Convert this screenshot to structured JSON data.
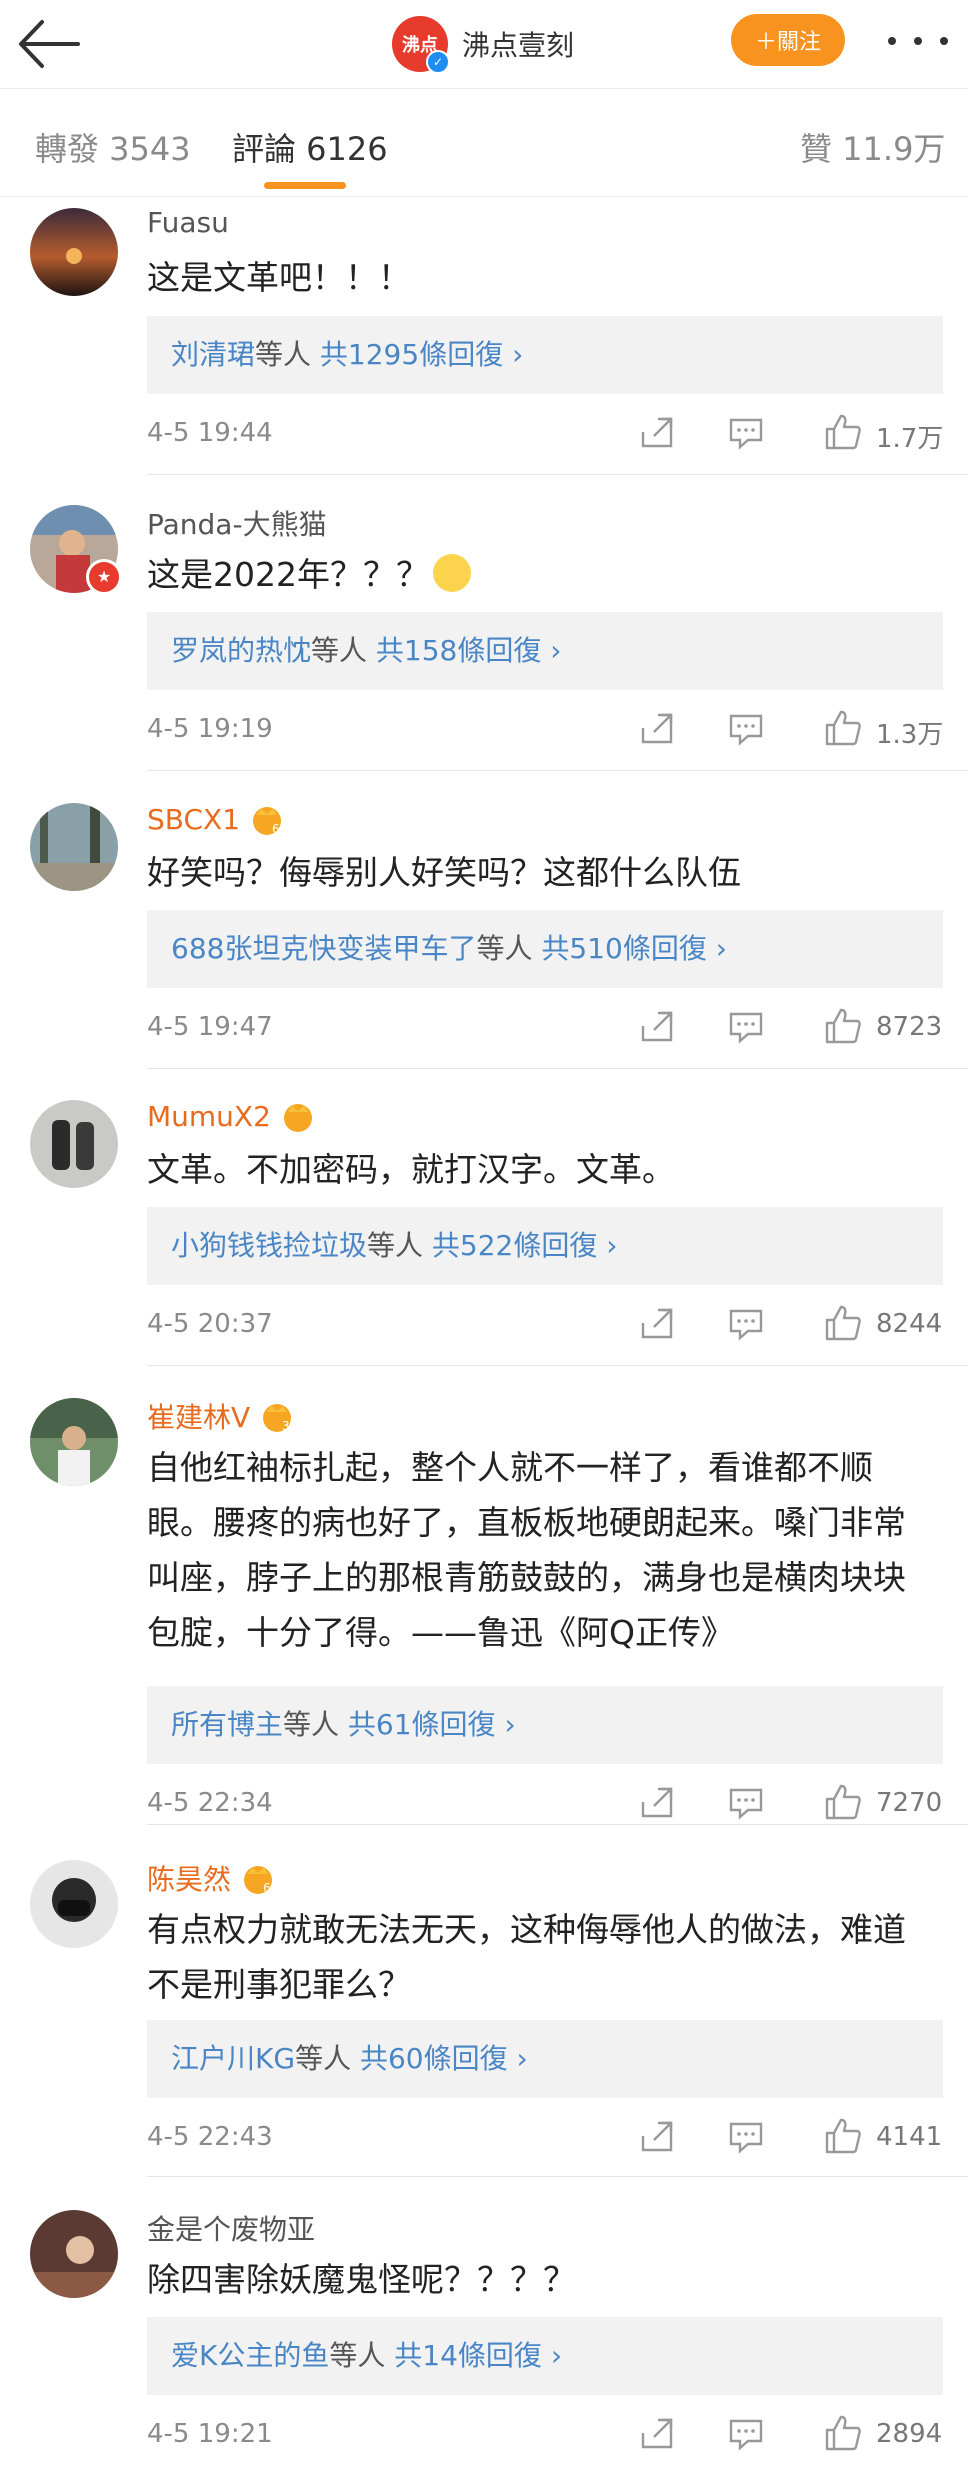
{
  "header": {
    "brand_logo_text": "沸点",
    "brand_name": "沸点壹刻",
    "follow_label": "＋關注"
  },
  "tabs": [
    {
      "label": "轉發 3543"
    },
    {
      "label": "評論 6126"
    },
    {
      "label": "贊 11.9万"
    }
  ],
  "comments": [
    {
      "name": "Fuasu",
      "text": "这是文革吧！！！",
      "reply_users": "刘清珺",
      "reply_etc": "等人",
      "reply_count": " 共1295條回復 ›",
      "time": "4-5 19:44",
      "likes": "1.7万"
    },
    {
      "name": "Panda-大熊猫",
      "text": "这是2022年？？？",
      "reply_users": "罗岚的热忱",
      "reply_etc": "等人",
      "reply_count": " 共158條回復 ›",
      "time": "4-5 19:19",
      "likes": "1.3万"
    },
    {
      "name": "SBCX1",
      "text": "好笑吗？侮辱别人好笑吗？这都什么队伍",
      "reply_users": "688张坦克快变装甲车了",
      "reply_etc": "等人",
      "reply_count": " 共510條回復 ›",
      "time": "4-5 19:47",
      "likes": "8723"
    },
    {
      "name": "MumuX2",
      "text": "文革。不加密码，就打汉字。文革。",
      "reply_users": "小狗钱钱捡垃圾",
      "reply_etc": "等人",
      "reply_count": " 共522條回復 ›",
      "time": "4-5 20:37",
      "likes": "8244"
    },
    {
      "name": "崔建林V",
      "text": "自他红袖标扎起，整个人就不一样了，看谁都不顺眼。腰疼的病也好了，直板板地硬朗起来。嗓门非常叫座，脖子上的那根青筋鼓鼓的，满身也是横肉块块包腚，十分了得。——鲁迅《阿Q正传》",
      "reply_users": "所有博主",
      "reply_etc": "等人",
      "reply_count": " 共61條回復 ›",
      "time": "4-5 22:34",
      "likes": "7270"
    },
    {
      "name": "陈昊然",
      "text": "有点权力就敢无法无天，这种侮辱他人的做法，难道不是刑事犯罪么？",
      "reply_users": "江户川KG",
      "reply_etc": "等人",
      "reply_count": " 共60條回復 ›",
      "time": "4-5 22:43",
      "likes": "4141"
    },
    {
      "name": "金是个废物亚",
      "text": "除四害除妖魔鬼怪呢？？？？",
      "reply_users": "爱K公主的鱼",
      "reply_etc": "等人",
      "reply_count": " 共14條回復 ›",
      "time": "4-5 19:21",
      "likes": "2894"
    }
  ]
}
